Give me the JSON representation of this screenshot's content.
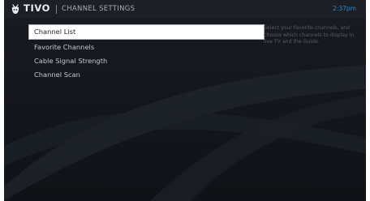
{
  "header": {
    "brand": "TIVO",
    "title": "CHANNEL SETTINGS",
    "time": "2:37pm"
  },
  "menu": {
    "items": [
      {
        "label": "Channel List",
        "selected": true
      },
      {
        "label": "Favorite Channels",
        "selected": false
      },
      {
        "label": "Cable Signal Strength",
        "selected": false
      },
      {
        "label": "Channel Scan",
        "selected": false
      }
    ]
  },
  "description": "Select your favorite channels, and choose which channels to display in live TV and the Guide.",
  "icons": {
    "logo": "tivo-logo-icon"
  },
  "colors": {
    "background": "#14171d",
    "header": "#1c1f25",
    "clock": "#2b88d2",
    "selected_bg": "#ffffff"
  }
}
